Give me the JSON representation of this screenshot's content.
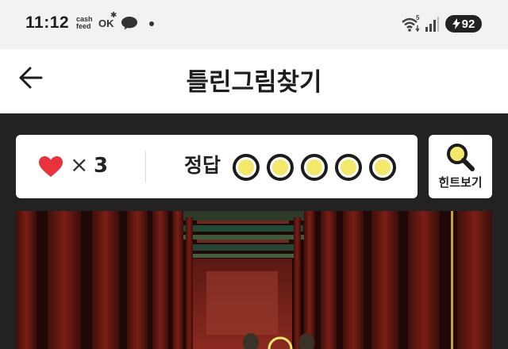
{
  "status_bar": {
    "time": "11:12",
    "notif_cashfeed": "cash feed",
    "notif_ok": "OK",
    "wifi_generation": "5",
    "battery": "92"
  },
  "app_bar": {
    "title": "틀린그림찾기"
  },
  "game_bar": {
    "lives_symbol": "×",
    "lives": "3",
    "answer_label": "정답",
    "answers_total": 5,
    "answers_found": 0
  },
  "hint_button": {
    "label": "힌트보기"
  },
  "colors": {
    "accent_yellow": "#f2e86a",
    "heart_red": "#e8333c",
    "background_dark": "#222222",
    "status_bar_bg": "#f2f2f2"
  },
  "icons": [
    "back-arrow-icon",
    "heart-icon",
    "magnifier-icon",
    "wifi-icon",
    "signal-icon",
    "battery-icon",
    "chat-icon"
  ]
}
